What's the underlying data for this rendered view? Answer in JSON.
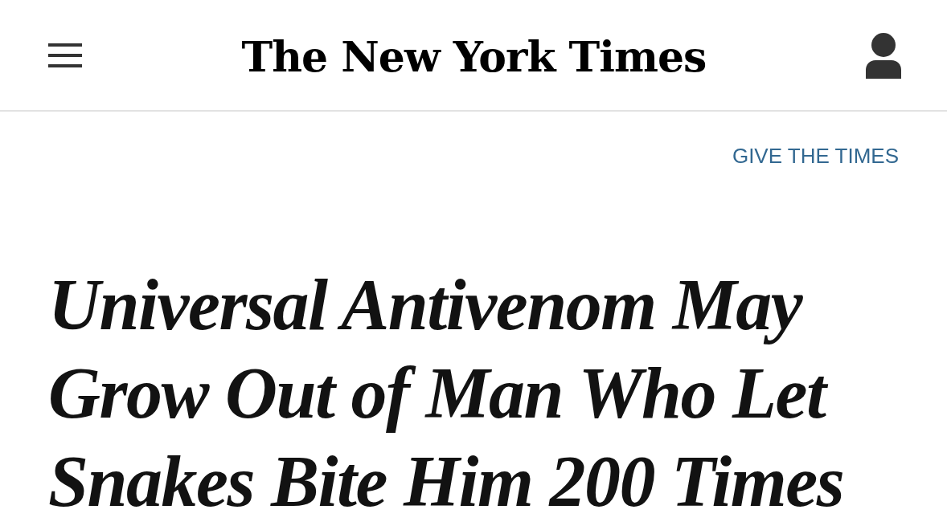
{
  "header": {
    "logo": "The New York Times"
  },
  "give_link": "GIVE THE TIMES",
  "headline": "Universal Antivenom May Grow Out of Man Who Let Snakes Bite Him 200 Times"
}
